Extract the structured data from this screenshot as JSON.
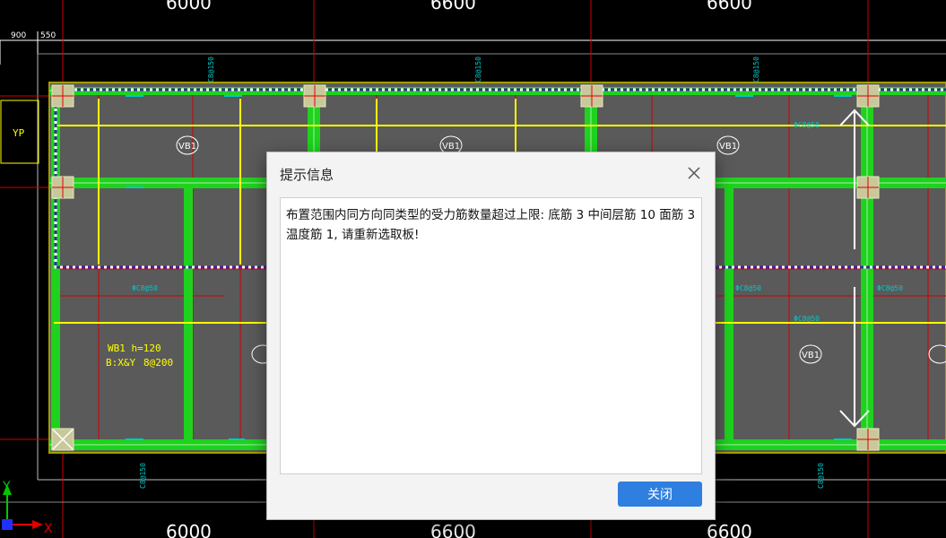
{
  "cad": {
    "dimensions_top": [
      "6000",
      "6600",
      "6600"
    ],
    "dimensions_bottom": [
      "6000",
      "6600",
      "6600"
    ],
    "small_dims": [
      "900",
      "550"
    ],
    "vertical_labels_top": [
      "C8@150",
      "C8@150",
      "C8@150"
    ],
    "vertical_labels_bottom": [
      "C8@150",
      "C8@150"
    ],
    "slab_label_line1": "WB1 h=120",
    "slab_label_line2": "B:X&Y",
    "slab_label_line2b": "8@200",
    "slab_circle_label": "VB1",
    "yp_label": "YP",
    "cyan_label": "ΦC8@50",
    "axis_x": "X",
    "axis_y": "Y",
    "colors": {
      "slab": "#5a5a5a",
      "beam": "#1ed21e",
      "axis_line": "#d00000",
      "yellow": "#ffff00",
      "cyan": "#00c8c8",
      "dialog_button": "#2f7fe0"
    }
  },
  "dialog": {
    "title": "提示信息",
    "message": "布置范围内同方向同类型的受力筋数量超过上限: 底筋 3 中间层筋 10 面筋 3 温度筋 1, 请重新选取板!",
    "close_button": "关闭",
    "close_icon": "close-icon"
  }
}
